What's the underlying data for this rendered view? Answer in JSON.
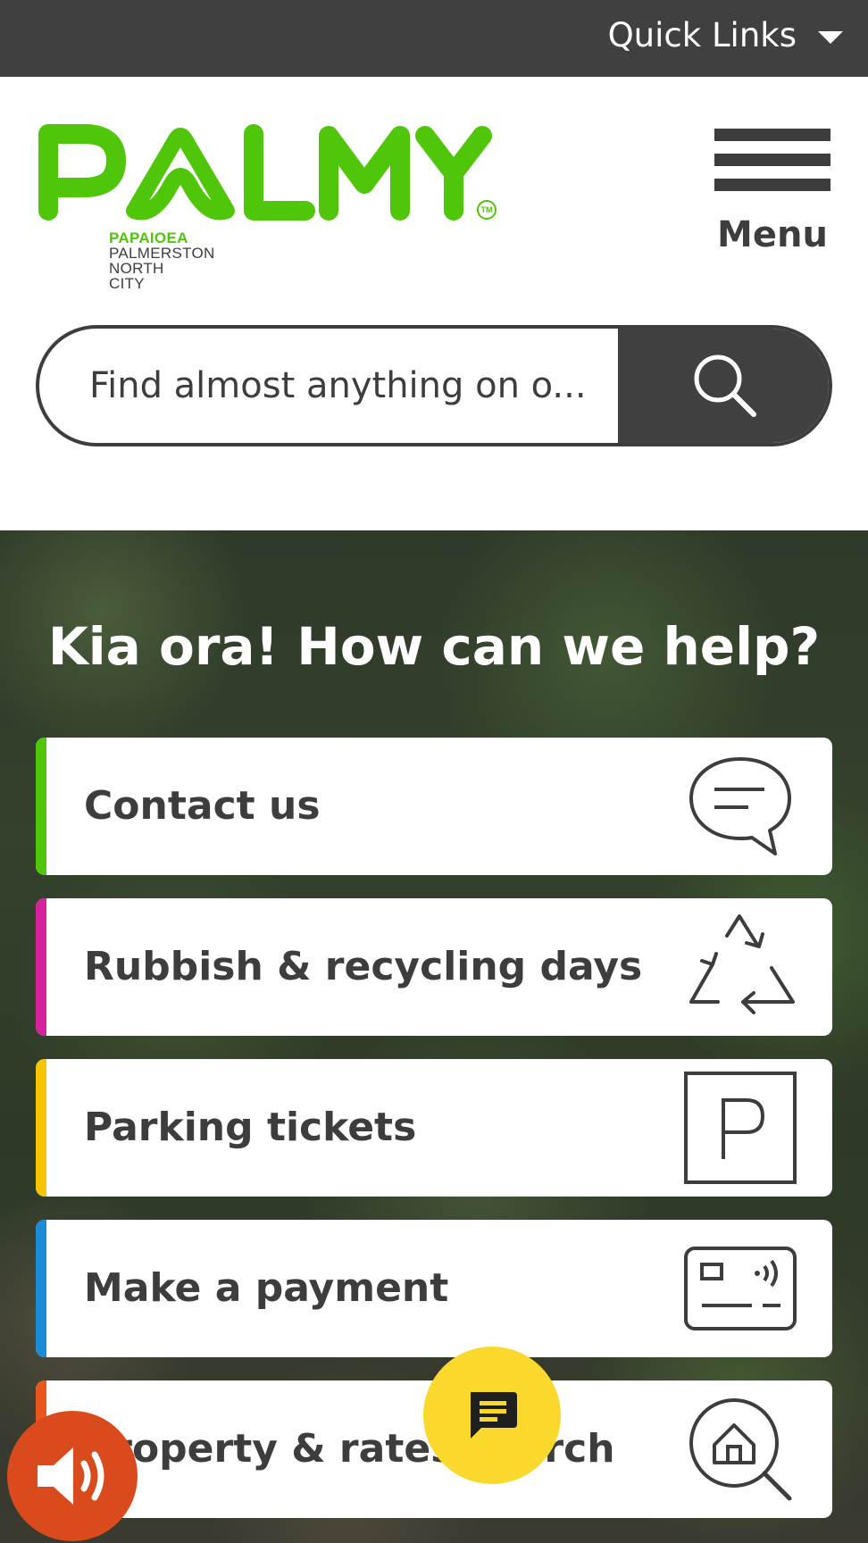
{
  "topbar": {
    "quick_links_label": "Quick Links"
  },
  "header": {
    "logo": {
      "wordmark": "PALMY",
      "tm": "TM",
      "tagline_maori": "PAPAIOEA",
      "tagline_lines": [
        "PALMERSTON",
        "NORTH",
        "CITY"
      ]
    },
    "menu_label": "Menu"
  },
  "search": {
    "placeholder": "Find almost anything on o..."
  },
  "hero": {
    "title": "Kia ora! How can we help?"
  },
  "quick_actions": [
    {
      "label": "Contact us",
      "accent": "#4fc60a",
      "icon": "speech-bubble-icon"
    },
    {
      "label": "Rubbish & recycling days",
      "accent": "#d6219c",
      "icon": "recycle-icon"
    },
    {
      "label": "Parking tickets",
      "accent": "#f7c500",
      "icon": "parking-sign-icon"
    },
    {
      "label": "Make a payment",
      "accent": "#1b8bd6",
      "icon": "payment-card-icon"
    },
    {
      "label": "Property & rates search",
      "accent": "#e8561b",
      "icon": "house-search-icon"
    }
  ],
  "floating": {
    "chat_icon": "chat-message-icon",
    "audio_icon": "speaker-icon"
  },
  "colors": {
    "brand_green": "#4fc60a",
    "dark_grey": "#404040",
    "chat_yellow": "#fbd92c",
    "audio_orange": "#d94a1d"
  }
}
